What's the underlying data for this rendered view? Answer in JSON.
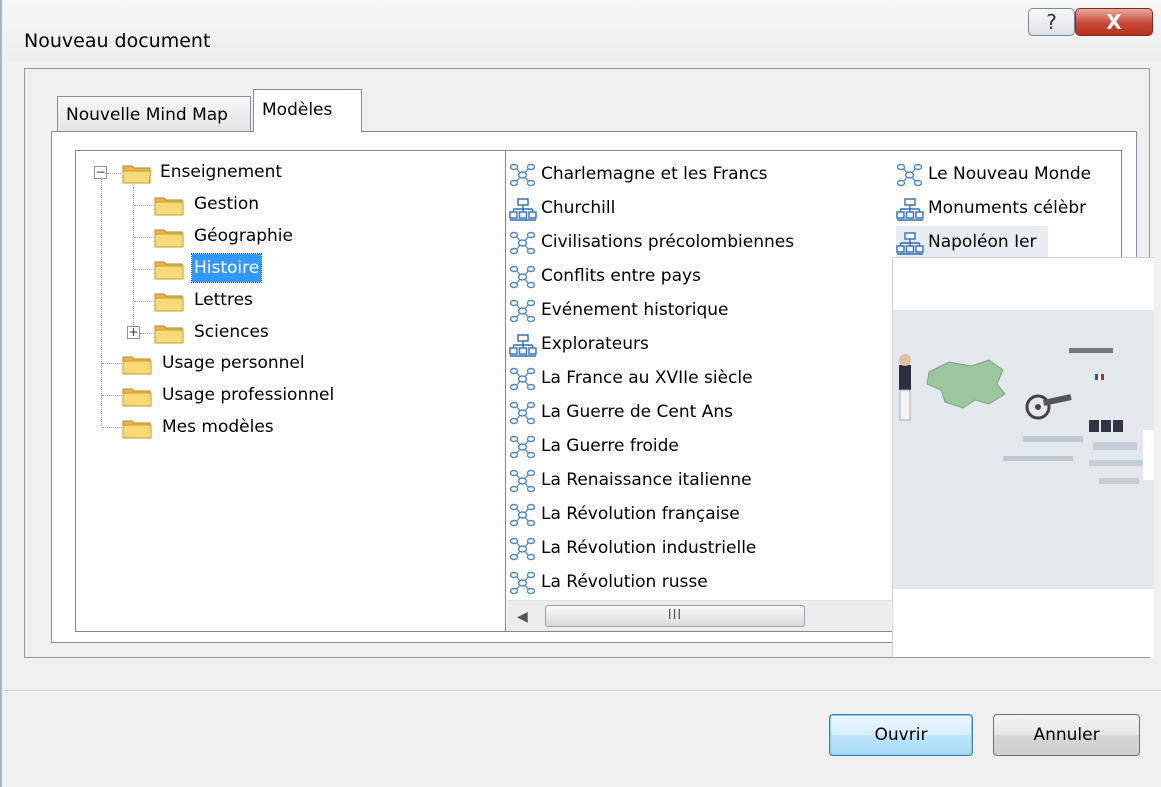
{
  "window": {
    "title": "Nouveau document",
    "help_glyph": "?",
    "close_glyph": "X"
  },
  "tabs": [
    {
      "label": "Nouvelle Mind Map",
      "active": false
    },
    {
      "label": "Modèles",
      "active": true
    }
  ],
  "tree": {
    "items": [
      {
        "label": "Enseignement",
        "expander": "−",
        "level": 0,
        "selected": false
      },
      {
        "label": "Gestion",
        "level": 1,
        "selected": false
      },
      {
        "label": "Géographie",
        "level": 1,
        "selected": false
      },
      {
        "label": "Histoire",
        "level": 1,
        "selected": true
      },
      {
        "label": "Lettres",
        "level": 1,
        "selected": false
      },
      {
        "label": "Sciences",
        "expander": "+",
        "level": 1,
        "selected": false
      },
      {
        "label": "Usage personnel",
        "level": 0,
        "selected": false
      },
      {
        "label": "Usage professionnel",
        "level": 0,
        "selected": false
      },
      {
        "label": "Mes modèles",
        "level": 0,
        "selected": false
      }
    ]
  },
  "templates": {
    "column1": [
      {
        "label": "Charlemagne et les Francs",
        "icon": "mindmap-icon"
      },
      {
        "label": "Churchill",
        "icon": "orgchart-icon"
      },
      {
        "label": "Civilisations précolombiennes",
        "icon": "mindmap-icon"
      },
      {
        "label": "Conflits entre pays",
        "icon": "mindmap-icon"
      },
      {
        "label": "Evénement historique",
        "icon": "mindmap-icon"
      },
      {
        "label": "Explorateurs",
        "icon": "orgchart-icon"
      },
      {
        "label": "La France au XVIIe siècle",
        "icon": "mindmap-icon"
      },
      {
        "label": "La Guerre de Cent Ans",
        "icon": "mindmap-icon"
      },
      {
        "label": "La Guerre froide",
        "icon": "mindmap-icon"
      },
      {
        "label": "La Renaissance italienne",
        "icon": "mindmap-icon"
      },
      {
        "label": "La Révolution française",
        "icon": "mindmap-icon"
      },
      {
        "label": "La Révolution industrielle",
        "icon": "mindmap-icon"
      },
      {
        "label": "La Révolution russe",
        "icon": "mindmap-icon"
      }
    ],
    "column2": [
      {
        "label": "Le Nouveau Monde",
        "icon": "mindmap-icon"
      },
      {
        "label": "Monuments célèbr",
        "icon": "orgchart-icon"
      },
      {
        "label": "Napoléon Ier",
        "icon": "orgchart-icon",
        "highlighted": true
      }
    ]
  },
  "scrollbar": {
    "grip": "III"
  },
  "buttons": {
    "open": "Ouvrir",
    "cancel": "Annuler"
  },
  "colors": {
    "selection": "#3399ff",
    "accent_button": "#3c7fb1"
  }
}
